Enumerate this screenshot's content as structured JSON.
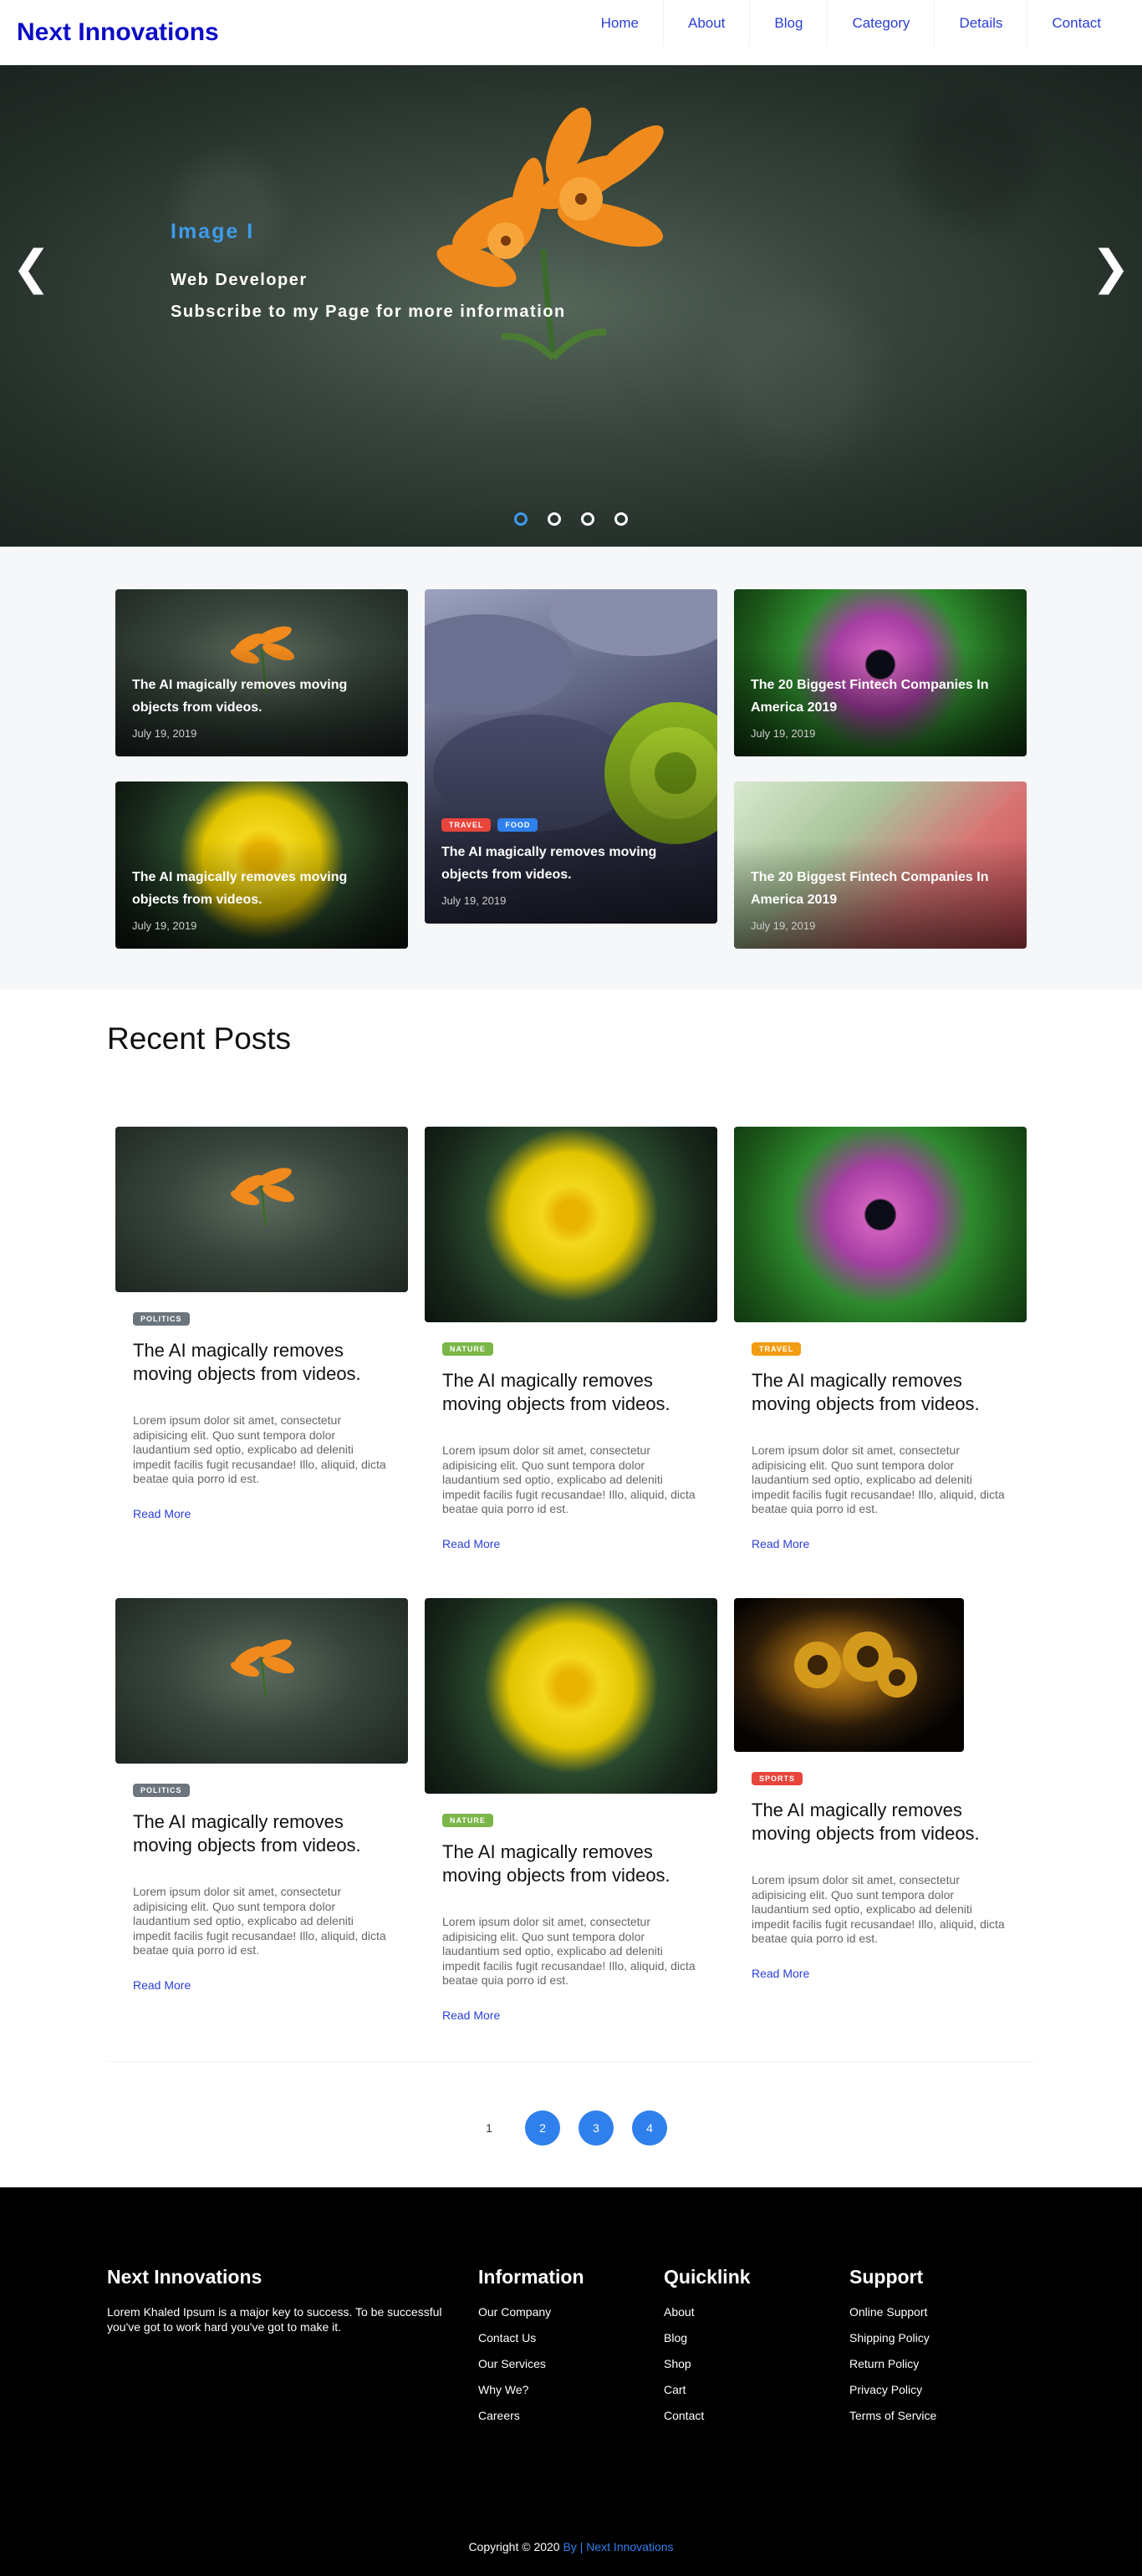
{
  "nav": {
    "brand": "Next Innovations",
    "items": [
      "Home",
      "About",
      "Blog",
      "Category",
      "Details",
      "Contact"
    ]
  },
  "hero": {
    "label": "Image I",
    "line1": "Web Developer",
    "line2": "Subscribe to my Page for more information",
    "prev": "❮",
    "next": "❯",
    "slides": 4,
    "active_slide": 1
  },
  "featured": [
    {
      "title": "The AI magically removes moving objects from videos.",
      "date": "July 19, 2019",
      "tags": []
    },
    {
      "title": "The AI magically removes moving objects from videos.",
      "date": "July 19, 2019",
      "tags": [
        {
          "label": "TRAVEL",
          "color": "#e8453c"
        },
        {
          "label": "FOOD",
          "color": "#2f80ed"
        }
      ]
    },
    {
      "title": "The 20 Biggest Fintech Companies In America 2019",
      "date": "July 19, 2019",
      "tags": []
    },
    {
      "title": "The AI magically removes moving objects from videos.",
      "date": "July 19, 2019",
      "tags": []
    },
    {
      "title": "The 20 Biggest Fintech Companies In America 2019",
      "date": "July 19, 2019",
      "tags": []
    }
  ],
  "recent": {
    "heading": "Recent Posts",
    "posts": [
      {
        "tag": "POLITICS",
        "tag_color": "#6c757d",
        "title": "The AI magically removes moving objects from videos.",
        "excerpt": "Lorem ipsum dolor sit amet, consectetur adipisicing elit. Quo sunt tempora dolor laudantium sed optio, explicabo ad deleniti impedit facilis fugit recusandae! Illo, aliquid, dicta beatae quia porro id est.",
        "more": "Read More"
      },
      {
        "tag": "NATURE",
        "tag_color": "#7ab648",
        "title": "The AI magically removes moving objects from videos.",
        "excerpt": "Lorem ipsum dolor sit amet, consectetur adipisicing elit. Quo sunt tempora dolor laudantium sed optio, explicabo ad deleniti impedit facilis fugit recusandae! Illo, aliquid, dicta beatae quia porro id est.",
        "more": "Read More"
      },
      {
        "tag": "TRAVEL",
        "tag_color": "#f39c12",
        "title": "The AI magically removes moving objects from videos.",
        "excerpt": "Lorem ipsum dolor sit amet, consectetur adipisicing elit. Quo sunt tempora dolor laudantium sed optio, explicabo ad deleniti impedit facilis fugit recusandae! Illo, aliquid, dicta beatae quia porro id est.",
        "more": "Read More"
      },
      {
        "tag": "POLITICS",
        "tag_color": "#6c757d",
        "title": "The AI magically removes moving objects from videos.",
        "excerpt": "Lorem ipsum dolor sit amet, consectetur adipisicing elit. Quo sunt tempora dolor laudantium sed optio, explicabo ad deleniti impedit facilis fugit recusandae! Illo, aliquid, dicta beatae quia porro id est.",
        "more": "Read More"
      },
      {
        "tag": "NATURE",
        "tag_color": "#7ab648",
        "title": "The AI magically removes moving objects from videos.",
        "excerpt": "Lorem ipsum dolor sit amet, consectetur adipisicing elit. Quo sunt tempora dolor laudantium sed optio, explicabo ad deleniti impedit facilis fugit recusandae! Illo, aliquid, dicta beatae quia porro id est.",
        "more": "Read More"
      },
      {
        "tag": "SPORTS",
        "tag_color": "#e8453c",
        "title": "The AI magically removes moving objects from videos.",
        "excerpt": "Lorem ipsum dolor sit amet, consectetur adipisicing elit. Quo sunt tempora dolor laudantium sed optio, explicabo ad deleniti impedit facilis fugit recusandae! Illo, aliquid, dicta beatae quia porro id est.",
        "more": "Read More"
      }
    ]
  },
  "pagination": [
    "1",
    "2",
    "3",
    "4"
  ],
  "footer": {
    "brand": "Next Innovations",
    "about": "Lorem Khaled Ipsum is a major key to success. To be successful you've got to work hard you've got to make it.",
    "columns": [
      {
        "heading": "Information",
        "links": [
          "Our Company",
          "Contact Us",
          "Our Services",
          "Why We?",
          "Careers"
        ]
      },
      {
        "heading": "Quicklink",
        "links": [
          "About",
          "Blog",
          "Shop",
          "Cart",
          "Contact"
        ]
      },
      {
        "heading": "Support",
        "links": [
          "Online Support",
          "Shipping Policy",
          "Return Policy",
          "Privacy Policy",
          "Terms of Service"
        ]
      }
    ],
    "copyright_prefix": "Copyright © 2020",
    "copyright_by": "By",
    "copyright_sep": " | ",
    "copyright_brand": "Next Innovations"
  }
}
